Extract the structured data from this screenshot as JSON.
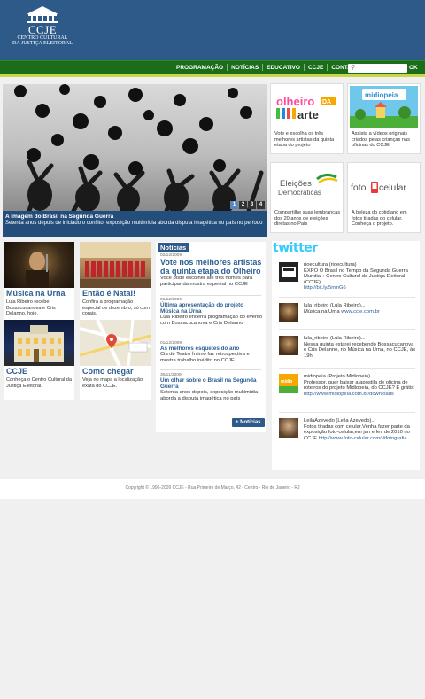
{
  "header": {
    "logo_title": "CCJE",
    "logo_sub_1": "CENTRO CULTURAL",
    "logo_sub_2": "DA JUSTIÇA ELEITORAL"
  },
  "nav": {
    "items": [
      "PROGRAMAÇÃO",
      "NOTÍCIAS",
      "EDUCATIVO",
      "CCJE",
      "CONTATO"
    ],
    "search_placeholder": "",
    "ok_label": "OK"
  },
  "hero": {
    "title": "A Imagem do Brasil na Segunda Guerra",
    "description": "Setenta anos depois de iniciado o conflito, exposição multimídia aborda disputa imagética no país no período",
    "pages": [
      "1",
      "2",
      "3",
      "4"
    ],
    "active_page": 1
  },
  "features": [
    {
      "logo": "olheiro da arte",
      "text": "Vote e escolha os três melhores artistas da quinta etapa do projeto"
    },
    {
      "logo": "midiopeia",
      "text": "Assista a vídeos originais criados pelas crianças nas oficinas do CCJE"
    },
    {
      "logo": "Eleições Democráticas",
      "text": "Compartilhe suas lembranças dos 20 anos de eleições diretas no País"
    },
    {
      "logo": "foto celular",
      "text": "A beleza do cotidiano em fotos tiradas do celular. Conheça o projeto."
    }
  ],
  "tiles": [
    {
      "title": "Música na Urna",
      "text": "Lula Ribeiro recebe Bossacucanova e Cris Delanno, hoje."
    },
    {
      "title": "Então é Natal!",
      "text": "Confira a programação especial de dezembro, só com corais."
    },
    {
      "title": "CCJE",
      "text": "Conheça o Centro Cultural da Justiça Eleitoral."
    },
    {
      "title": "Como chegar",
      "text": "Veja no mapa a localização exata do CCJE."
    }
  ],
  "news": {
    "header": "Notícias",
    "items": [
      {
        "date": "02/12/2009",
        "title": "Vote nos melhores artistas da quinta etapa do Olheiro",
        "text": "Você pode escolher até três nomes para participar da mostra especial no CCJE"
      },
      {
        "date": "01/12/2009",
        "title": "Última apresentação do projeto Música na Urna",
        "text": "Lula Ribeiro encerra programação do evento com Bossacucanova e Cris Delanno"
      },
      {
        "date": "01/12/2009",
        "title": "As melhores esquetes do ano",
        "text": "Cia de Teatro Íntimo faz retrospectiva e mostra trabalho inédito no CCJE"
      },
      {
        "date": "30/11/2009",
        "title": "Um olhar sobre o Brasil na Segunda Guerra",
        "text": "Setenta anos depois, exposição multimídia aborda a disputa imagética no país"
      }
    ],
    "more_label": "Notícias"
  },
  "twitter": {
    "logo": "twitter",
    "tweets": [
      {
        "user": "rioecultura (rioecultura)",
        "text": "EXPO O Brasil no Tempo da Segunda Guerra Mundial : Centro Cultural da Justiça Eleitoral (CCJE):",
        "link": "http://bit.ly/5rrmG6"
      },
      {
        "user": "lula_ribeiro (Lula Ribeiro)...",
        "text": "Música na Urna",
        "link": "www.ccje.com.br"
      },
      {
        "user": "lula_ribeiro (Lula Ribeiro)...",
        "text": "Nessa quinta estarei recebendo Bossacucanova e Cris Delanno, no Música na Urna, no CCJE, às 19h.",
        "link": ""
      },
      {
        "user": "midiopeia (Projeto Midiopeia)...",
        "text": "Professor, quer baixar a apostila de oficina de roteiros do projeto Midiopeia, do CCJE? É grátis:",
        "link": "http://www.midiopeia.com.br/downloads"
      },
      {
        "user": "LeilaAzevedo (Leila Azevedo)...",
        "text": "Fotos tiradas com celular.Venha fazer parte da exposição foto-celular,em jan e fev de 2010 no CCJE",
        "link": "http://www.foto-celular.com/ #fotografia"
      }
    ]
  },
  "footer": {
    "text": "Copyright © 1996-2009 CCJE - Rua Primeiro de Março, 42 - Centro - Rio de Janeiro - RJ"
  }
}
